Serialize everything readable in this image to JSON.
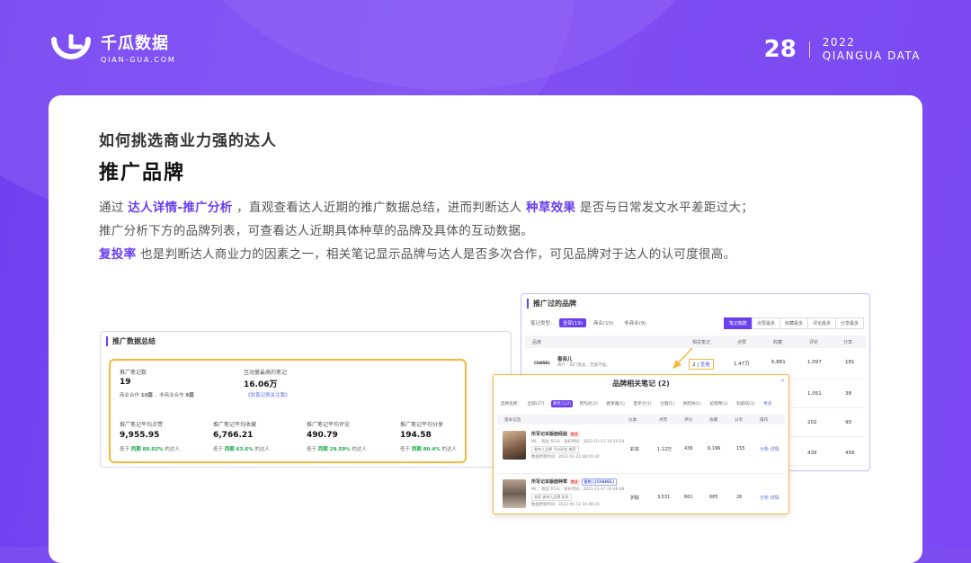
{
  "brand": {
    "name_cn": "千瓜数据",
    "name_en": "QIAN-GUA.COM",
    "accent": "#6a3ff0"
  },
  "page": {
    "number": "28",
    "year": "2022",
    "tagline": "QIANGUA DATA"
  },
  "subtitle": "如何挑选商业力强的达人",
  "title": "推广品牌",
  "para": {
    "l1a": "通过 ",
    "l1b": "达人详情-推广分析",
    "l1c": " ，直观查看达人近期的推广数据总结，进而判断达人 ",
    "l1d": "种草效果",
    "l1e": " 是否与日常发文水平差距过大；",
    "l2": "推广分析下方的品牌列表，可查看达人近期具体种草的品牌及具体的互动数据。",
    "l3a": "复投率",
    "l3b": " 也是判断达人商业力的因素之一，相关笔记显示品牌与达人是否多次合作，可见品牌对于达人的认可度很高。"
  },
  "summary": {
    "title": "推广数据总结",
    "notes_label": "推广笔记数",
    "notes_val": "19",
    "notes_sub_a": "商业合作 ",
    "notes_sub_b": "10篇",
    "notes_sub_c": " ，非商业合作 ",
    "notes_sub_d": "9篇",
    "inter_label": "互动量最高的笔记",
    "inter_val": "16.06万",
    "inter_link": "《欢喜记得关注我》",
    "metrics": [
      {
        "label": "推广笔记平均点赞",
        "val": "9,955.95",
        "cmp_a": "低于 ",
        "cmp_b": "同期 88.02%",
        "cmp_c": " 的达人"
      },
      {
        "label": "推广笔记平均收藏",
        "val": "6,766.21",
        "cmp_a": "低于 ",
        "cmp_b": "同期 63.6%",
        "cmp_c": " 的达人"
      },
      {
        "label": "推广笔记平均评论",
        "val": "490.79",
        "cmp_a": "低于 ",
        "cmp_b": "同期 29.59%",
        "cmp_c": " 的达人"
      },
      {
        "label": "推广笔记平均分享",
        "val": "194.58",
        "cmp_a": "低于 ",
        "cmp_b": "同期 80.4%",
        "cmp_c": " 的达人"
      }
    ]
  },
  "brands": {
    "title": "推广过的品牌",
    "type_label": "笔记类型:",
    "tabs": [
      "全部(19)",
      "商业(10)",
      "非商业(9)"
    ],
    "segs": [
      "笔记篇数",
      "点赞最多",
      "收藏最多",
      "评论最多",
      "分享最多"
    ],
    "headers": [
      "品牌",
      "相关笔记",
      "点赞",
      "收藏",
      "评论",
      "分享"
    ],
    "row1": {
      "name": "香奈儿",
      "logo": "CHANEL",
      "desc": "简介：四门香卖、无痕不脱。",
      "notes": "2",
      "view": "查看",
      "likes": "1.47万",
      "fav": "6,881",
      "comments": "1,097",
      "share": "181"
    },
    "extra_rows": [
      {
        "comments": "1,051",
        "share": "38"
      },
      {
        "comments": "202",
        "share": "90"
      },
      {
        "comments": "439",
        "share": "456"
      }
    ]
  },
  "popup": {
    "title": "品牌相关笔记 (2)",
    "close": "×",
    "tab_label": "品牌名称:",
    "tabs": [
      "全部(27)",
      "香奈儿(2)",
      "阿玛尼(2)",
      "欧莱雅(1)",
      "圣罗兰(1)",
      "兰蔻(1)",
      "娇韵诗(1)",
      "纪梵希(1)",
      "科颜氏(1)",
      "更多"
    ],
    "headers": [
      "基本信息",
      "分类",
      "点赞",
      "评论",
      "收藏",
      "分享",
      "操作"
    ],
    "notes": [
      {
        "title": "所写记本版面经验",
        "badge": "商业",
        "meta": "ML...  粉丝 653L · 发布时间：2022-01-15 19:14:54",
        "tags": "香奈儿品牌  平价彩妆  推荐",
        "updated": "数据更新时间：2022-01-21 08:01:44",
        "cat": "彩妆",
        "likes": "1.12万",
        "comments": "436",
        "fav": "6,196",
        "share": "155",
        "ops": "分析 详情"
      },
      {
        "title": "所写记本版面种草",
        "badge": "商业",
        "badge2": "香奈儿(CHANEL)",
        "meta": "ML...  粉丝 653L · 发布时间：2022-12-07 20:46:08",
        "tags": "妆容  香奈儿品牌  彩妆",
        "updated": "数据更新时间：2022-01-11 16:48:20",
        "cat": "护肤",
        "likes": "3,531",
        "comments": "661",
        "fav": "685",
        "share": "26",
        "ops": "分析 详情"
      }
    ]
  }
}
